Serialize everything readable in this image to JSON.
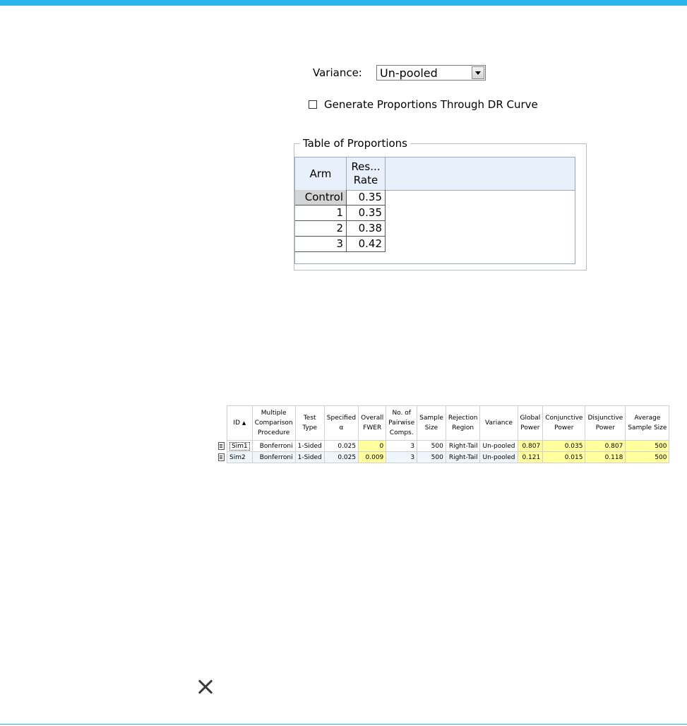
{
  "variance": {
    "label": "Variance:",
    "value": "Un-pooled"
  },
  "checkbox": {
    "label": "Generate Proportions Through DR Curve",
    "checked": false
  },
  "proportions": {
    "title": "Table of Proportions",
    "headers": {
      "arm": "Arm",
      "rate_line1": "Res...",
      "rate_line2": "Rate"
    },
    "rows": [
      {
        "arm": "Control",
        "rate": "0.35"
      },
      {
        "arm": "1",
        "rate": "0.35"
      },
      {
        "arm": "2",
        "rate": "0.38"
      },
      {
        "arm": "3",
        "rate": "0.42"
      }
    ]
  },
  "results": {
    "headers": {
      "id": "ID",
      "mcp": [
        "Multiple",
        "Comparison",
        "Procedure"
      ],
      "test_type": [
        "Test",
        "Type"
      ],
      "specified": [
        "Specified",
        "α"
      ],
      "fwer": [
        "Overall",
        "FWER"
      ],
      "pairwise": [
        "No. of",
        "Pairwise",
        "Comps."
      ],
      "sample": [
        "Sample",
        "Size"
      ],
      "rejection": [
        "Rejection",
        "Region"
      ],
      "variance": "Variance",
      "global": [
        "Global",
        "Power"
      ],
      "conjunctive": [
        "Conjunctive",
        "Power"
      ],
      "disjunctive": [
        "Disjunctive",
        "Power"
      ],
      "avg": [
        "Average",
        "Sample Size"
      ]
    },
    "rows": [
      {
        "id": "Sim1",
        "mcp": "Bonferroni",
        "test_type": "1-Sided",
        "specified": "0.025",
        "fwer": "0",
        "pairwise": "3",
        "sample": "500",
        "rejection": "Right-Tail",
        "variance": "Un-pooled",
        "global": "0.807",
        "conjunctive": "0.035",
        "disjunctive": "0.807",
        "avg": "500"
      },
      {
        "id": "Sim2",
        "mcp": "Bonferroni",
        "test_type": "1-Sided",
        "specified": "0.025",
        "fwer": "0.009",
        "pairwise": "3",
        "sample": "500",
        "rejection": "Right-Tail",
        "variance": "Un-pooled",
        "global": "0.121",
        "conjunctive": "0.015",
        "disjunctive": "0.118",
        "avg": "500"
      }
    ]
  },
  "icons": {
    "row_icon": "simulation-doc-icon",
    "close": "close-icon"
  },
  "colors": {
    "accent": "#2bb5ea",
    "highlight": "#ffff9e",
    "header_bg": "#e8f1fb"
  }
}
